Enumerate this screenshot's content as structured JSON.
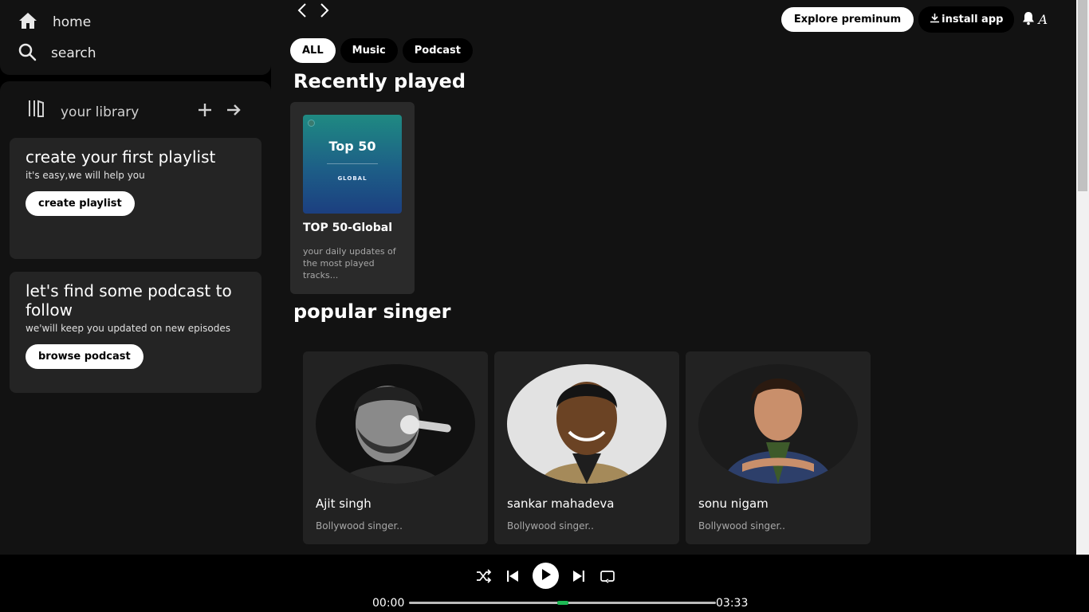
{
  "sidebar": {
    "home_label": "home",
    "search_label": "search",
    "library_label": "your library",
    "playlist_card": {
      "title": "create your first playlist",
      "subtitle": "it's easy,we will help you",
      "button": "create playlist"
    },
    "podcast_card": {
      "title": "let's find some podcast to follow",
      "subtitle": "we'will keep you updated on new episodes",
      "button": "browse podcast"
    }
  },
  "header": {
    "premium_button": "Explore preminum",
    "install_button": "install app",
    "avatar_letter": "A"
  },
  "filters": [
    "ALL",
    "Music",
    "Podcast"
  ],
  "sections": {
    "recent_title": "Recently played",
    "popular_title": "popular singer"
  },
  "recent": {
    "cover_title": "Top 50",
    "cover_subtitle": "GLOBAL",
    "name": "TOP 50-Global",
    "description": "your daily updates of the most played tracks..."
  },
  "singers": [
    {
      "name": "Ajit singh",
      "description": "Bollywood singer.."
    },
    {
      "name": "sankar mahadeva",
      "description": "Bollywood singer.."
    },
    {
      "name": "sonu nigam",
      "description": "Bollywood singer.."
    }
  ],
  "player": {
    "current_time": "00:00",
    "total_time": "03:33",
    "progress_fraction": 0.5,
    "accent_color": "#1db954"
  }
}
